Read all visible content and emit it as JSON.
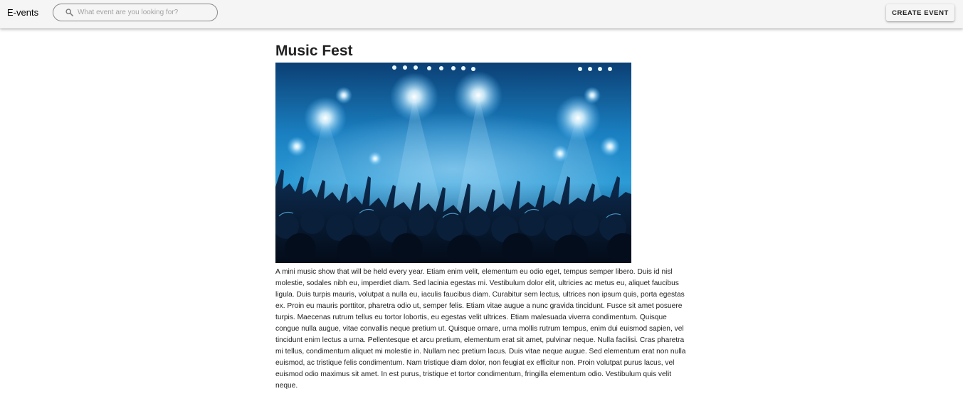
{
  "header": {
    "brand": "E-vents",
    "search": {
      "placeholder": "What event are you looking for?",
      "value": ""
    },
    "create_button_label": "CREATE EVENT"
  },
  "event": {
    "title": "Music Fest",
    "image": {
      "subject": "concert crowd with stage lights",
      "dominant_color": "#1a7fc0"
    },
    "description": "A mini music show that will be held every year. Etiam enim velit, elementum eu odio eget, tempus semper libero. Duis id nisl molestie, sodales nibh eu, imperdiet diam. Sed lacinia egestas mi. Vestibulum dolor elit, ultricies ac metus eu, aliquet faucibus ligula. Duis turpis mauris, volutpat a nulla eu, iaculis faucibus diam. Curabitur sem lectus, ultrices non ipsum quis, porta egestas ex. Proin eu mauris porttitor, pharetra odio ut, semper felis. Etiam vitae augue a nunc gravida tincidunt. Fusce sit amet posuere turpis. Maecenas rutrum tellus eu tortor lobortis, eu egestas velit ultrices. Etiam malesuada viverra condimentum. Quisque congue nulla augue, vitae convallis neque pretium ut. Quisque ornare, urna mollis rutrum tempus, enim dui euismod sapien, vel tincidunt enim lectus a urna. Pellentesque et arcu pretium, elementum erat sit amet, pulvinar neque. Nulla facilisi. Cras pharetra mi tellus, condimentum aliquet mi molestie in. Nullam nec pretium lacus. Duis vitae neque augue. Sed elementum erat non nulla euismod, ac tristique felis condimentum. Nam tristique diam dolor, non feugiat ex efficitur non. Proin volutpat purus lacus, vel euismod odio maximus sit amet. In est purus, tristique et tortor condimentum, fringilla elementum odio. Vestibulum quis velit neque."
  },
  "colors": {
    "appbar_background": "#f5f5f5",
    "text_primary": "#212121",
    "stage_light_blue": "#1a7fc0"
  }
}
